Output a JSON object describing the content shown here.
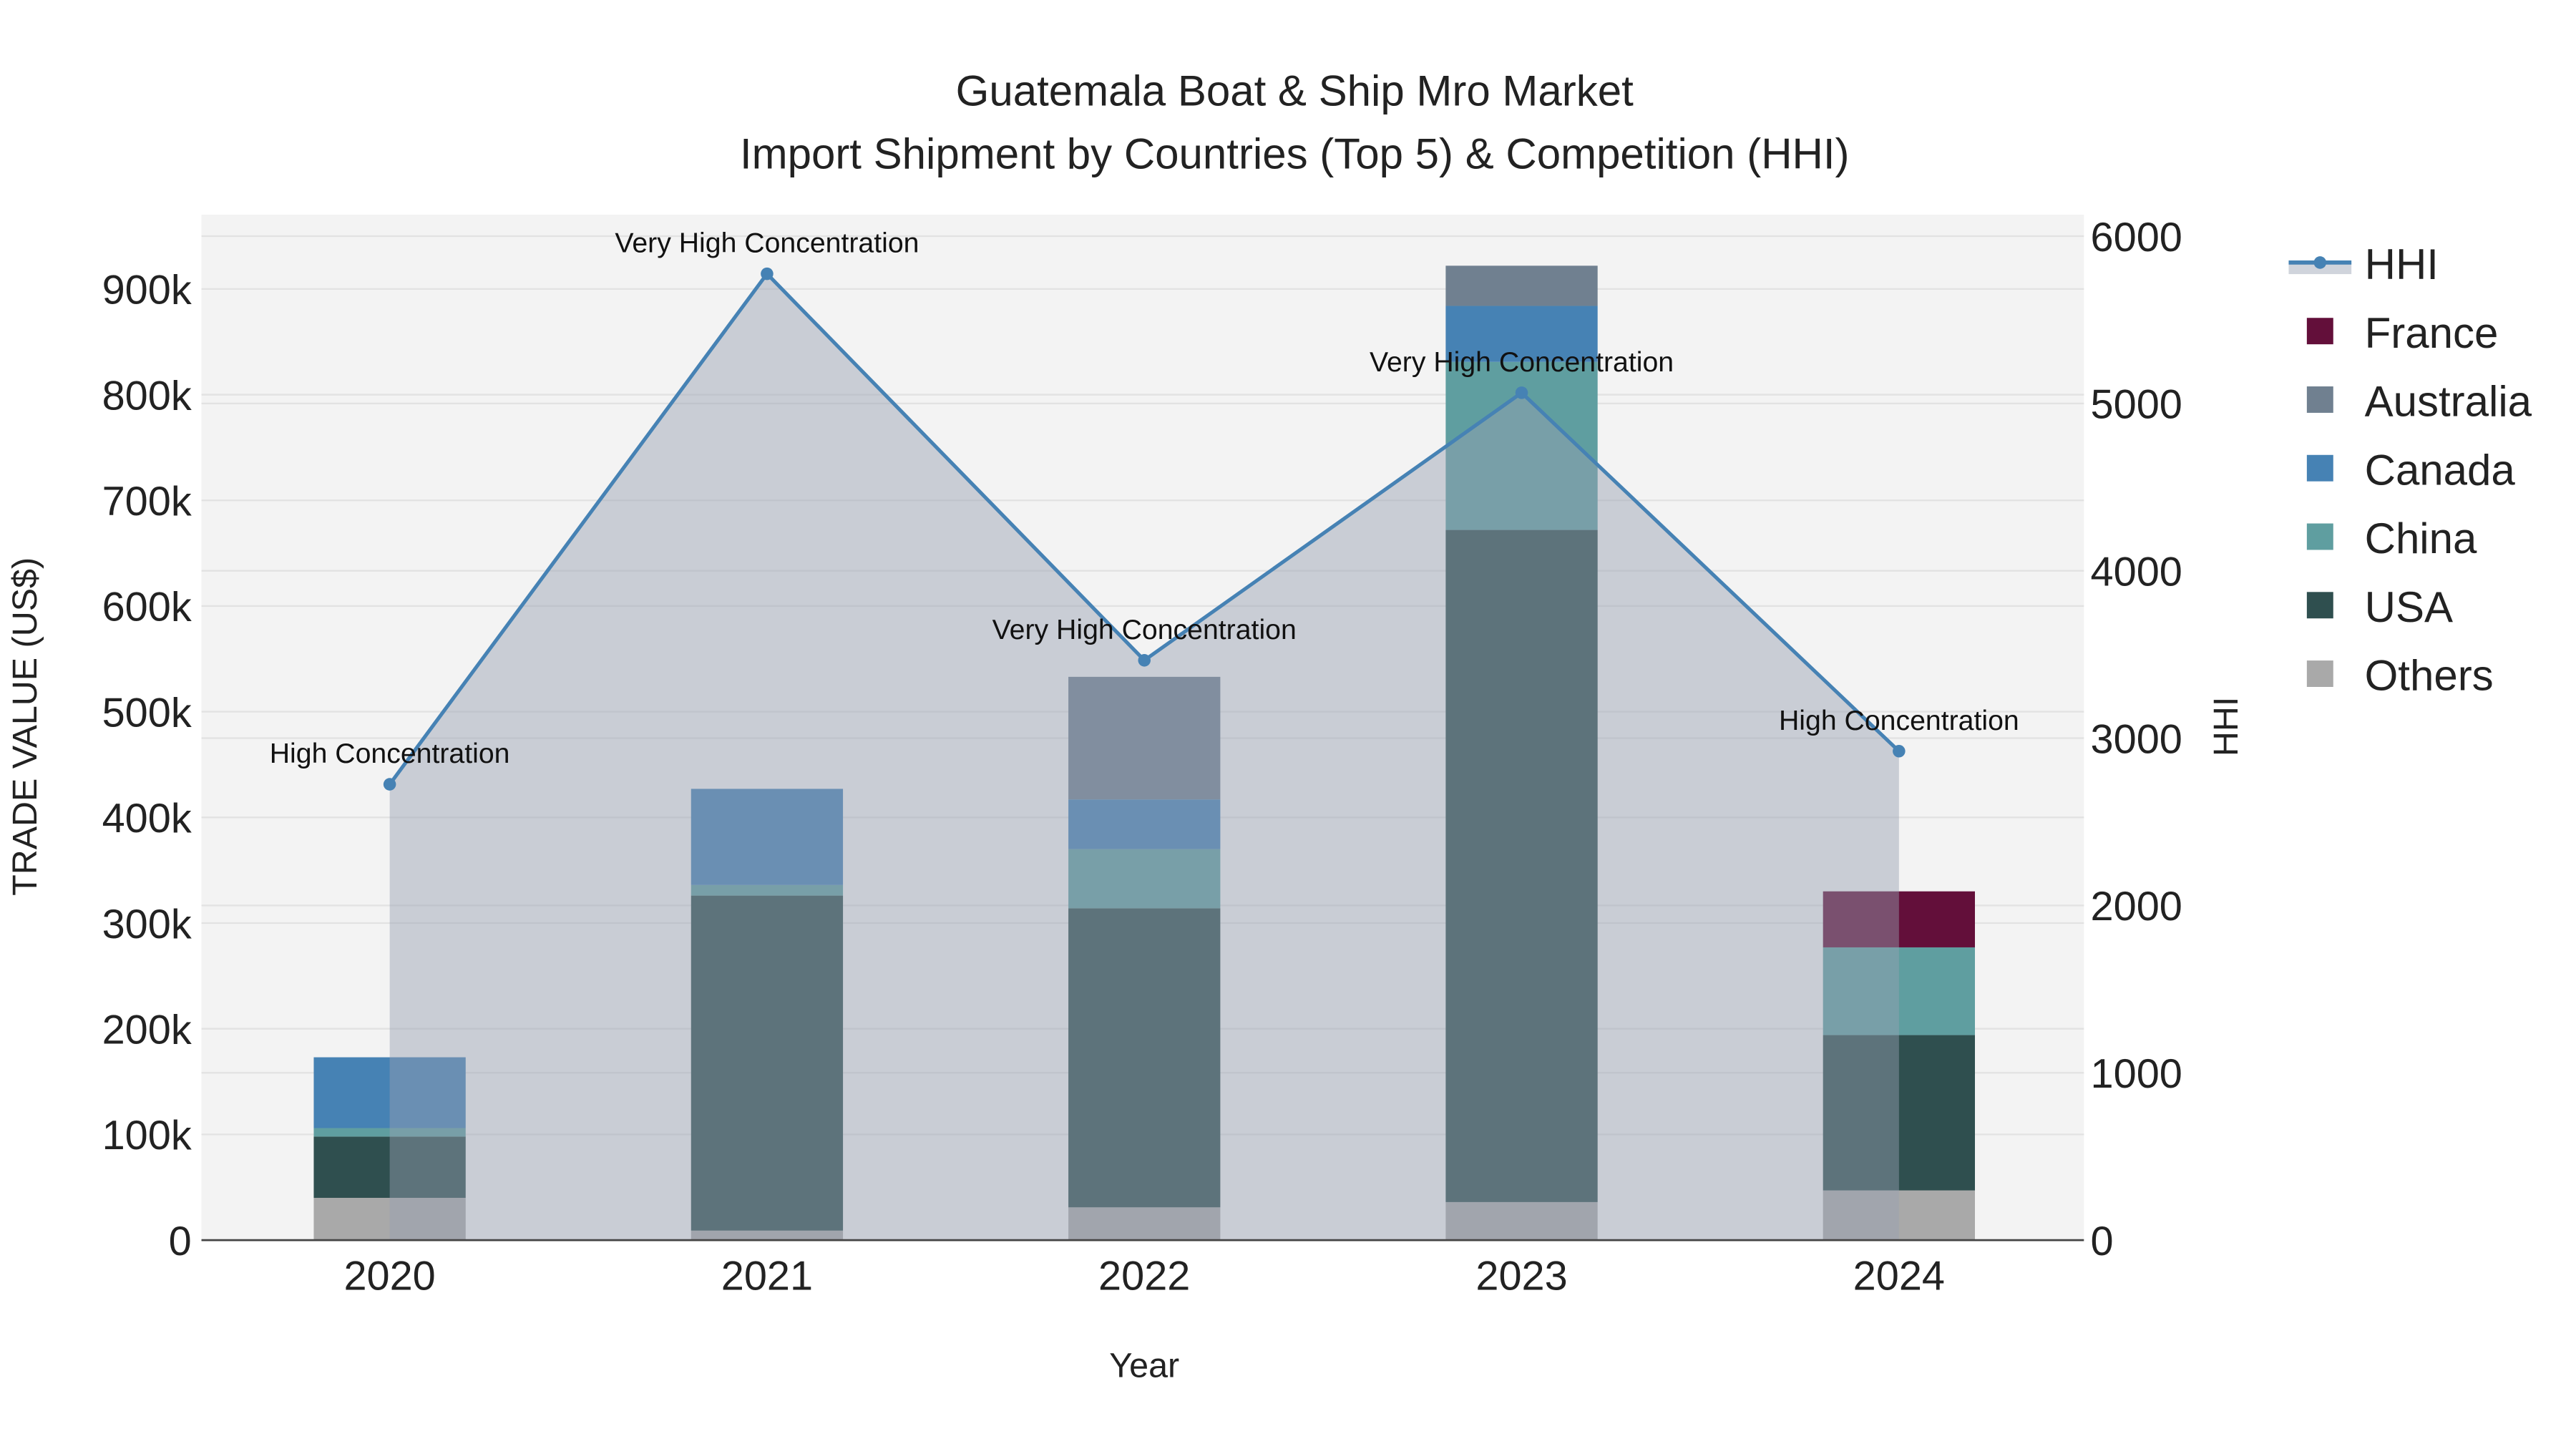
{
  "chart_data": {
    "type": "bar",
    "title_line1": "Guatemala Boat & Ship Mro Market",
    "title_line2": "Import Shipment by Countries (Top 5) & Competition (HHI)",
    "xlabel": "Year",
    "ylabel": "TRADE VALUE (US$)",
    "y2label": "HHI",
    "categories": [
      "2020",
      "2021",
      "2022",
      "2023",
      "2024"
    ],
    "ylim": [
      0,
      970000
    ],
    "y2lim": [
      0,
      6150
    ],
    "yticks": [
      0,
      100000,
      200000,
      300000,
      400000,
      500000,
      600000,
      700000,
      800000,
      900000
    ],
    "ytick_labels": [
      "0",
      "100k",
      "200k",
      "300k",
      "400k",
      "500k",
      "600k",
      "700k",
      "800k",
      "900k"
    ],
    "y2ticks": [
      0,
      1000,
      2000,
      3000,
      4000,
      5000,
      6000
    ],
    "y2tick_labels": [
      "0",
      "1000",
      "2000",
      "3000",
      "4000",
      "5000",
      "6000"
    ],
    "series": [
      {
        "name": "Others",
        "color": "#a9a9a9",
        "values": [
          40000,
          9000,
          31000,
          36000,
          47000
        ]
      },
      {
        "name": "USA",
        "color": "#2f4f4f",
        "values": [
          58000,
          317000,
          283000,
          636000,
          147000
        ]
      },
      {
        "name": "China",
        "color": "#5f9ea0",
        "values": [
          8000,
          10000,
          56000,
          159000,
          83000
        ]
      },
      {
        "name": "Canada",
        "color": "#4682b4",
        "values": [
          67000,
          91000,
          47000,
          53000,
          0
        ]
      },
      {
        "name": "Australia",
        "color": "#708090",
        "values": [
          0,
          0,
          116000,
          38000,
          0
        ]
      },
      {
        "name": "France",
        "color": "#630f3a",
        "values": [
          0,
          0,
          0,
          0,
          53000
        ]
      }
    ],
    "hhi": {
      "name": "HHI",
      "color": "#4682b4",
      "values": [
        2724,
        5775,
        3465,
        5064,
        2922
      ]
    },
    "annotations": [
      "High Concentration",
      "Very High Concentration",
      "Very High Concentration",
      "Very High Concentration",
      "High Concentration"
    ],
    "legend_order": [
      "HHI",
      "France",
      "Australia",
      "Canada",
      "China",
      "USA",
      "Others"
    ],
    "legend_position": "right",
    "grid": true
  }
}
